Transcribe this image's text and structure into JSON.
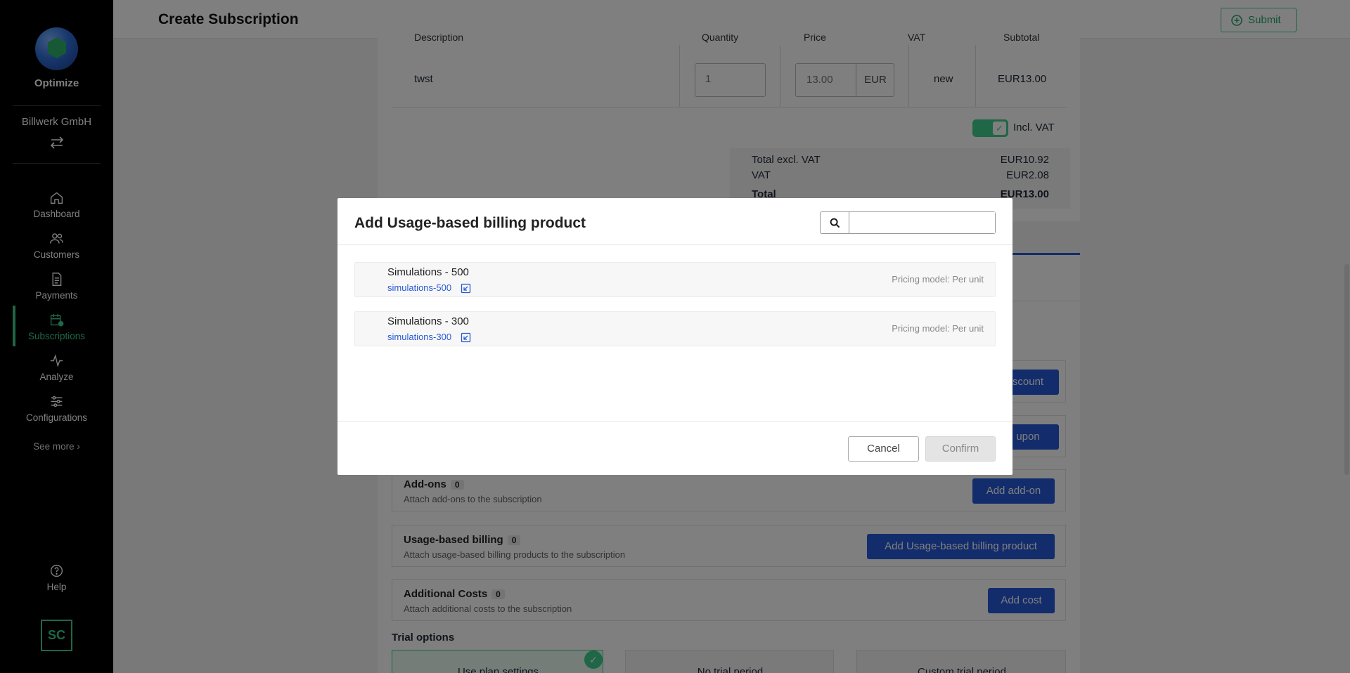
{
  "sidebar": {
    "app_name": "Optimize",
    "org_name": "Billwerk GmbH",
    "items": [
      {
        "label": "Dashboard"
      },
      {
        "label": "Customers"
      },
      {
        "label": "Payments"
      },
      {
        "label": "Subscriptions"
      },
      {
        "label": "Analyze"
      },
      {
        "label": "Configurations"
      }
    ],
    "see_more": "See more",
    "help": "Help",
    "avatar_initials": "SC",
    "accent_color": "#3ecf8e"
  },
  "header": {
    "title": "Create Subscription",
    "submit_label": "Submit"
  },
  "order_lines": {
    "columns": [
      "Description",
      "Quantity",
      "Price",
      "VAT",
      "Subtotal"
    ],
    "rows": [
      {
        "description": "twst",
        "quantity": "1",
        "price": "13.00",
        "currency": "EUR",
        "vat": "new",
        "subtotal": "EUR13.00"
      }
    ],
    "incl_vat_label": "Incl. VAT",
    "totals": {
      "excl_label": "Total excl. VAT",
      "excl_value": "EUR10.92",
      "vat_label": "VAT",
      "vat_value": "EUR2.08",
      "total_label": "Total",
      "total_value": "EUR13.00"
    }
  },
  "sections": {
    "discount_button": "scount",
    "coupon_button": "upon",
    "addons": {
      "title": "Add-ons",
      "count": "0",
      "desc": "Attach add-ons to the subscription",
      "button": "Add add-on"
    },
    "usage": {
      "title": "Usage-based billing",
      "count": "0",
      "desc": "Attach usage-based billing products to the subscription",
      "button": "Add Usage-based billing product"
    },
    "costs": {
      "title": "Additional Costs",
      "count": "0",
      "desc": "Attach additional costs to the subscription",
      "button": "Add cost"
    },
    "trial_title": "Trial options",
    "trial_options": [
      "Use plan settings",
      "No trial period",
      "Custom trial period"
    ]
  },
  "modal": {
    "title": "Add Usage-based billing product",
    "search_value": "",
    "products": [
      {
        "name": "Simulations - 500",
        "handle": "simulations-500",
        "pricing": "Pricing model: Per unit"
      },
      {
        "name": "Simulations - 300",
        "handle": "simulations-300",
        "pricing": "Pricing model: Per unit"
      }
    ],
    "cancel_label": "Cancel",
    "confirm_label": "Confirm"
  }
}
